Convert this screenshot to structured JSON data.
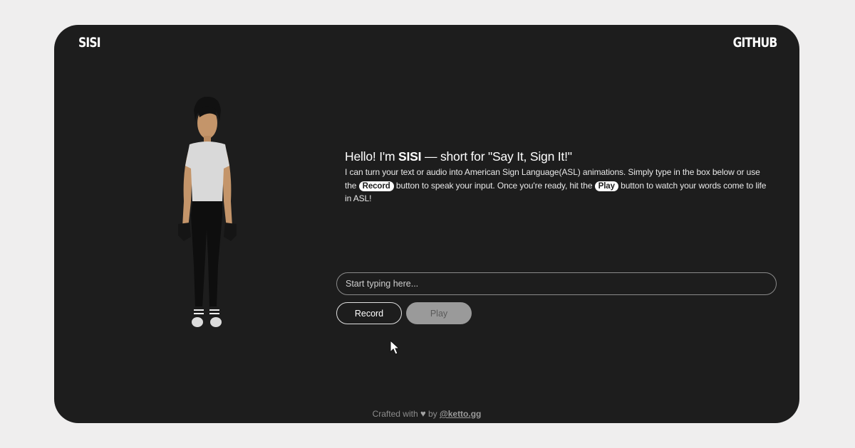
{
  "header": {
    "brand": "SISI",
    "github_link": "GITHUB"
  },
  "intro": {
    "greeting_prefix": "Hello! I'm ",
    "greeting_name": "SISI",
    "greeting_suffix": " — short for \"Say It, Sign It!\"",
    "desc_part1": "I can turn your text or audio into American Sign Language(ASL) animations. Simply type in the box below or use the ",
    "record_pill": "Record",
    "desc_part2": " button to speak your input. Once you're ready, hit the ",
    "play_pill": "Play",
    "desc_part3": " button to watch your words come to life in ASL!"
  },
  "input": {
    "placeholder": "Start typing here...",
    "value": ""
  },
  "buttons": {
    "record_label": "Record",
    "play_label": "Play"
  },
  "footer": {
    "crafted": "Crafted with ",
    "heart_icon": "heart-icon",
    "by": " by ",
    "handle": "@ketto.gg"
  },
  "colors": {
    "page_bg": "#efeeee",
    "window_bg": "#1d1d1d",
    "accent": "#ffffff",
    "play_disabled": "#9a9a9a"
  }
}
